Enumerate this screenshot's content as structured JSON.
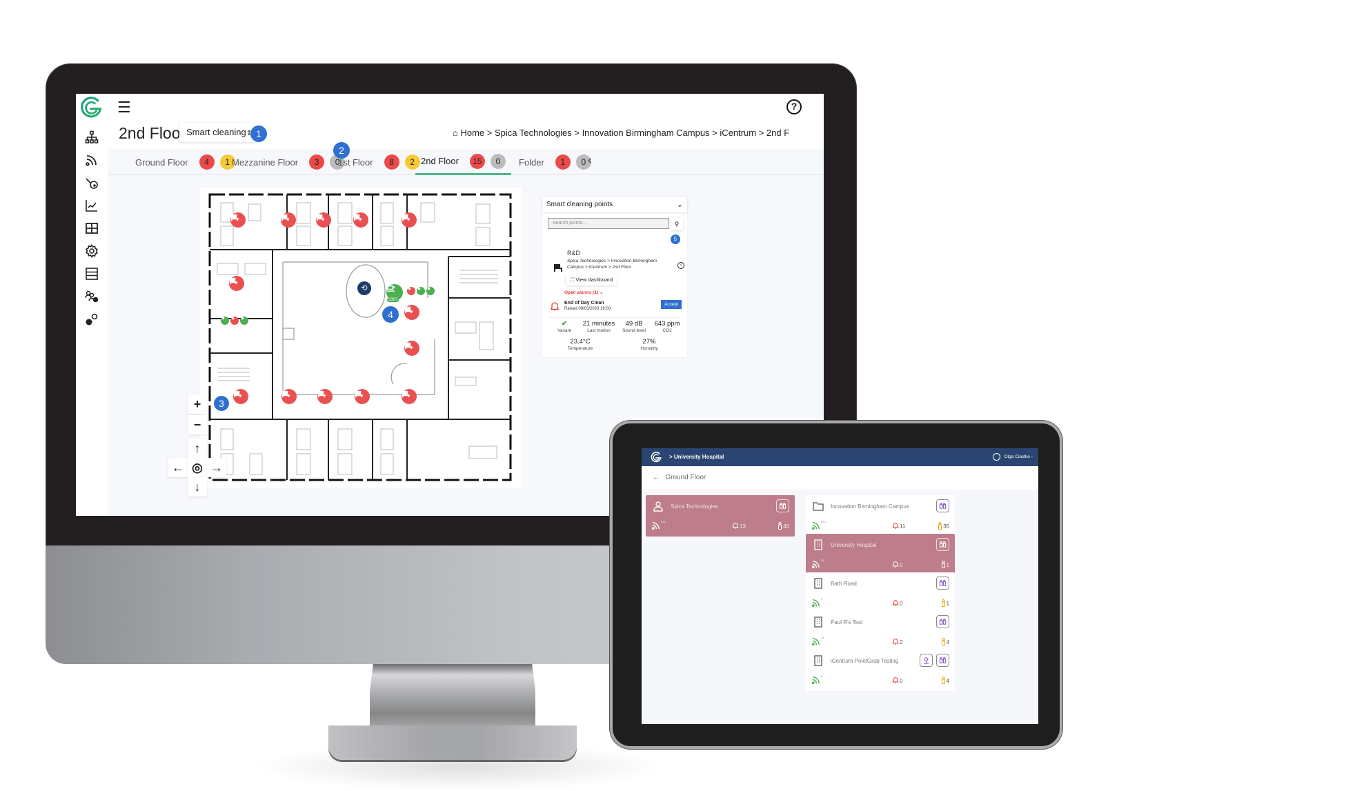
{
  "desktop": {
    "header": {
      "menu_icon": "hamburger-icon",
      "help_icon": "help-circle-icon",
      "help_glyph": "?"
    },
    "sidebar": {
      "items": [
        {
          "icon": "hierarchy-icon"
        },
        {
          "icon": "wireless-icon"
        },
        {
          "icon": "key-icon"
        },
        {
          "icon": "analytics-chart-icon"
        },
        {
          "icon": "grid-icon"
        },
        {
          "icon": "gear-icon"
        },
        {
          "icon": "server-list-icon"
        },
        {
          "icon": "users-settings-icon"
        },
        {
          "icon": "gears-icon"
        }
      ]
    },
    "page_title": "2nd Floor",
    "mode_select": {
      "value": "Smart cleaning",
      "arrow": "⇕"
    },
    "callouts": [
      "1",
      "2",
      "3",
      "4",
      "5"
    ],
    "breadcrumb": {
      "home_icon": "home-icon",
      "text": "Home > Spica Technologies > Innovation Birmingham Campus > iCentrum > 2nd F"
    },
    "floor_tabs": [
      {
        "label": "Ground Floor",
        "alarms": "4",
        "warnings": "1",
        "warning_color": "yellow",
        "active": false
      },
      {
        "label": "Mezzanine Floor",
        "alarms": "3",
        "warnings": "0",
        "warning_color": "grey",
        "active": false
      },
      {
        "label": "1st Floor",
        "alarms": "8",
        "warnings": "2",
        "warning_color": "yellow",
        "active": false
      },
      {
        "label": "2nd Floor",
        "alarms": "15",
        "warnings": "0",
        "warning_color": "grey",
        "active": true
      },
      {
        "label": "Folder",
        "alarms": "1",
        "warnings": "0",
        "warning_color": "grey",
        "active": false
      }
    ],
    "collapse_glyph": "‹",
    "map_controls": {
      "zoom_in": "+",
      "zoom_out": "−",
      "up": "↑",
      "down": "↓",
      "left": "←",
      "right": "→",
      "center": "◎"
    },
    "floorplan": {
      "kitchen_marker_label": "2307",
      "desk_markers_red": 15,
      "restroom_markers": [
        "green",
        "red",
        "green"
      ]
    },
    "panel": {
      "title": "Smart cleaning points",
      "search_placeholder": "Search points...",
      "point": {
        "name": "R&D",
        "path": "Spica Technologies > Innovation Birmingham Campus > iCentrum > 2nd Floor",
        "view_dashboard": "View dashboard",
        "open_alarms": "Open alarms (1) ⌄"
      },
      "alarm": {
        "title": "End of Day Clean",
        "raised": "Raised 09/03/2020 19:00.",
        "accept": "Accept"
      },
      "metrics": [
        {
          "value": "✔",
          "label": "Vacant"
        },
        {
          "value": "21 minutes",
          "label": "Last motion"
        },
        {
          "value": "49 dB",
          "label": "Sound level"
        },
        {
          "value": "643 ppm",
          "label": "CO2"
        },
        {
          "value": "23.4°C",
          "label": "Temperature"
        },
        {
          "value": "27%",
          "label": "Humidity"
        }
      ]
    },
    "colors": {
      "brand_green": "#1fa57a",
      "alarm_red": "#ea4a4a",
      "warning_yellow": "#f6c937",
      "accent_blue": "#2f6fd0",
      "active_tab_underline": "#4cb886"
    }
  },
  "tablet": {
    "breadcrumb": "> University Hospital",
    "user": "Olga Ciastko ◦",
    "subheader": "Ground Floor",
    "back_glyph": "←",
    "cards": [
      {
        "name": "Spica Technologies",
        "type": "person",
        "highlighted": true,
        "wifi": "325",
        "alarms": "13",
        "occupancy": "45"
      },
      {
        "name": "Innovation Birmingham Campus",
        "type": "folder",
        "highlighted": false,
        "wifi": "449",
        "alarms": "11",
        "occupancy": "35"
      },
      {
        "name": "University Hospital",
        "type": "building",
        "highlighted": true,
        "wifi": "25",
        "alarms": "0",
        "occupancy": "1"
      },
      {
        "name": "Bath Road",
        "type": "building",
        "highlighted": false,
        "wifi": "0",
        "alarms": "0",
        "occupancy": "1"
      },
      {
        "name": "Paul R's Test",
        "type": "building",
        "highlighted": false,
        "wifi": "23",
        "alarms": "2",
        "occupancy": "4"
      },
      {
        "name": "iCentrum PointGrab Testing",
        "type": "building",
        "highlighted": false,
        "wifi": "8",
        "alarms": "0",
        "occupancy": "4"
      }
    ],
    "colors": {
      "header_blue": "#2b4572",
      "highlight_pink": "#bd7d8a"
    }
  }
}
